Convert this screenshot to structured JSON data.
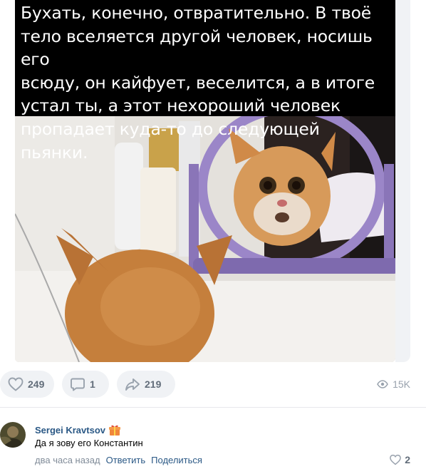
{
  "post": {
    "caption": "Бухать, конечно, отвратительно. В твоё\nтело вселяется другой человек, носишь его\nвсюду, он кайфует, веселится, а в итоге\nустал ты, а этот нехороший человек\nпропадает куда-то до следующей пьянки.",
    "image_semantic": "ginger-cat-looking-in-mirror-photo"
  },
  "actions": {
    "likes": "249",
    "comments": "1",
    "shares": "219",
    "views": "15K"
  },
  "comment": {
    "author": "Sergei Kravtsov",
    "text": "Да я зову его Константин",
    "time": "два часа назад",
    "reply_label": "Ответить",
    "share_label": "Поделиться",
    "likes": "2"
  },
  "colors": {
    "accent_link": "#2a5885",
    "button_bg": "#f0f2f5",
    "icon_gray": "#99a2ad",
    "count_gray": "#626d7a"
  }
}
